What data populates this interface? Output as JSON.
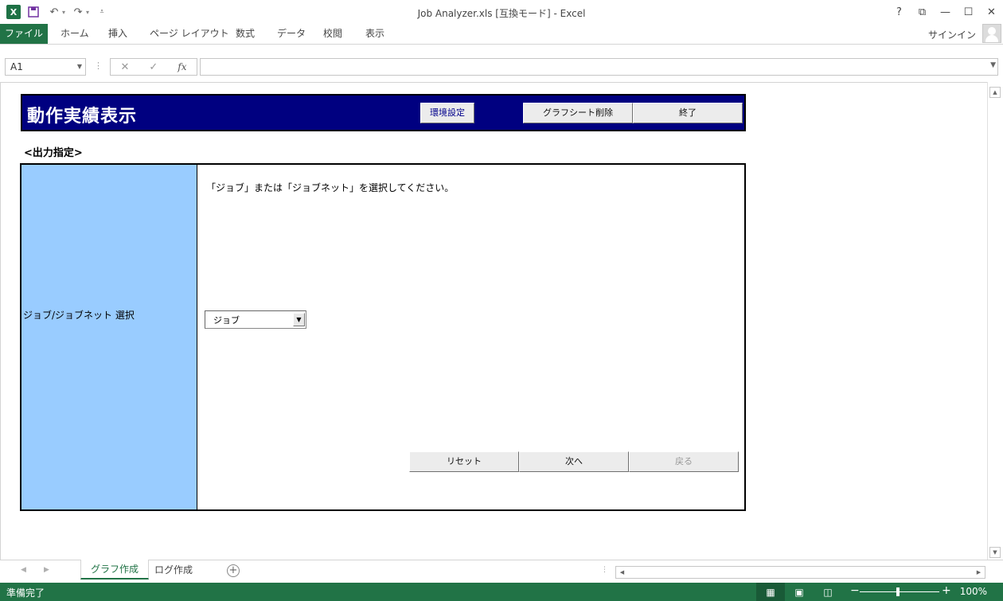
{
  "window": {
    "title": "Job Analyzer.xls  [互換モード] - Excel",
    "app_icon": "excel-icon",
    "controls": [
      "?",
      "⧉",
      "—",
      "☐",
      "✕"
    ]
  },
  "ribbon": {
    "file_label": "ファイル",
    "tabs": [
      "ホーム",
      "挿入",
      "ページ レイアウト",
      "数式",
      "データ",
      "校閲",
      "表示"
    ],
    "signin": "サインイン"
  },
  "formula_bar": {
    "name_box": "A1",
    "formula": ""
  },
  "sheet": {
    "title": "動作実績表示",
    "env_button": "環境設定",
    "delete_button": "グラフシート削除",
    "exit_button": "終了",
    "section_label": "<出力指定>",
    "row_label": "ジョブ/ジョブネット 選択",
    "instruction": "「ジョブ」または「ジョブネット」を選択してください。",
    "select_value": "ジョブ",
    "reset_button": "リセット",
    "next_button": "次へ",
    "back_button": "戻る"
  },
  "sheet_tabs": {
    "items": [
      "グラフ作成",
      "ログ作成"
    ],
    "active": "グラフ作成"
  },
  "status": {
    "text": "準備完了",
    "zoom": "100%"
  },
  "colors": {
    "excel_green": "#217346",
    "header_bg": "#000080",
    "label_bg": "#99ccff"
  }
}
